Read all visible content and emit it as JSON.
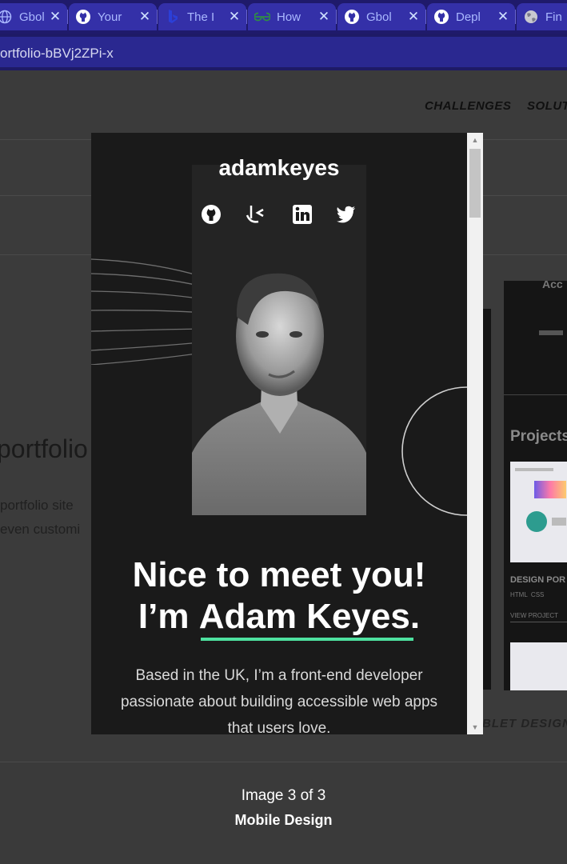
{
  "browser": {
    "tabs": [
      {
        "label": "Gbol",
        "icon": "globe-icon",
        "icon_color": "#aab8ff"
      },
      {
        "label": "Your",
        "icon": "github-icon",
        "icon_color": "#ffffff"
      },
      {
        "label": "The I",
        "icon": "bing-icon",
        "icon_color": "#2b3fd8"
      },
      {
        "label": "How",
        "icon": "geeksforgeeks-icon",
        "icon_color": "#2f8d46"
      },
      {
        "label": "Gbol",
        "icon": "github-icon",
        "icon_color": "#ffffff"
      },
      {
        "label": "Depl",
        "icon": "github-icon",
        "icon_color": "#ffffff"
      },
      {
        "label": "Fin",
        "icon": "globe-icon",
        "icon_color": "#c8c8d0"
      }
    ],
    "close_glyph": "✕",
    "url": "ortfolio-bBVj2ZPi-x"
  },
  "page": {
    "nav": [
      "CHALLENGES",
      "SOLUT"
    ],
    "title": "portfolio",
    "desc_lines": [
      "portfolio site",
      "even customi"
    ],
    "tablet_label": "BLET DESIGN",
    "right_card": {
      "heading": "Acc",
      "projects_heading": "Projects",
      "project_title": "DESIGN POR",
      "tags": "HTML  CSS",
      "view_link": "VIEW PROJECT"
    }
  },
  "modal": {
    "brand": "adamkeyes",
    "social_icons": [
      "github-icon",
      "frontend-mentor-icon",
      "linkedin-icon",
      "twitter-icon"
    ],
    "headline_line1": "Nice to meet you!",
    "headline_prefix": "I’m ",
    "headline_name": "Adam Keyes.",
    "body": "Based in the UK, I’m a front-end developer passionate about building accessible web apps that users love.",
    "accent_color": "#4ee1a0"
  },
  "caption": {
    "counter": "Image 3 of 3",
    "title": "Mobile Design"
  }
}
